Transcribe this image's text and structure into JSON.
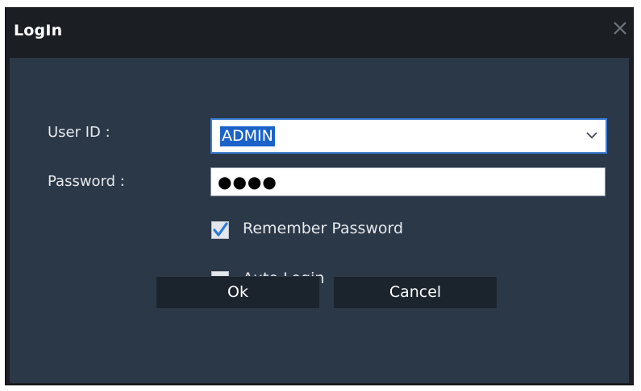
{
  "window": {
    "title": "LogIn"
  },
  "form": {
    "user_id_label": "User ID :",
    "user_id_value": "ADMIN",
    "password_label": "Password :",
    "password_value": "●●●●",
    "remember_label": "Remember Password",
    "remember_checked": true,
    "auto_login_label": "Auto Login",
    "auto_login_checked": false
  },
  "buttons": {
    "ok_label": "Ok",
    "cancel_label": "Cancel"
  },
  "colors": {
    "titlebar": "#1b1f24",
    "panel": "#2b3848",
    "selection": "#1b62c9",
    "focus_border": "#3c7fd6",
    "check_mark": "#2e7ad8"
  },
  "icons": {
    "close": "close-icon",
    "dropdown": "chevron-down-icon",
    "check": "checkmark-icon"
  }
}
